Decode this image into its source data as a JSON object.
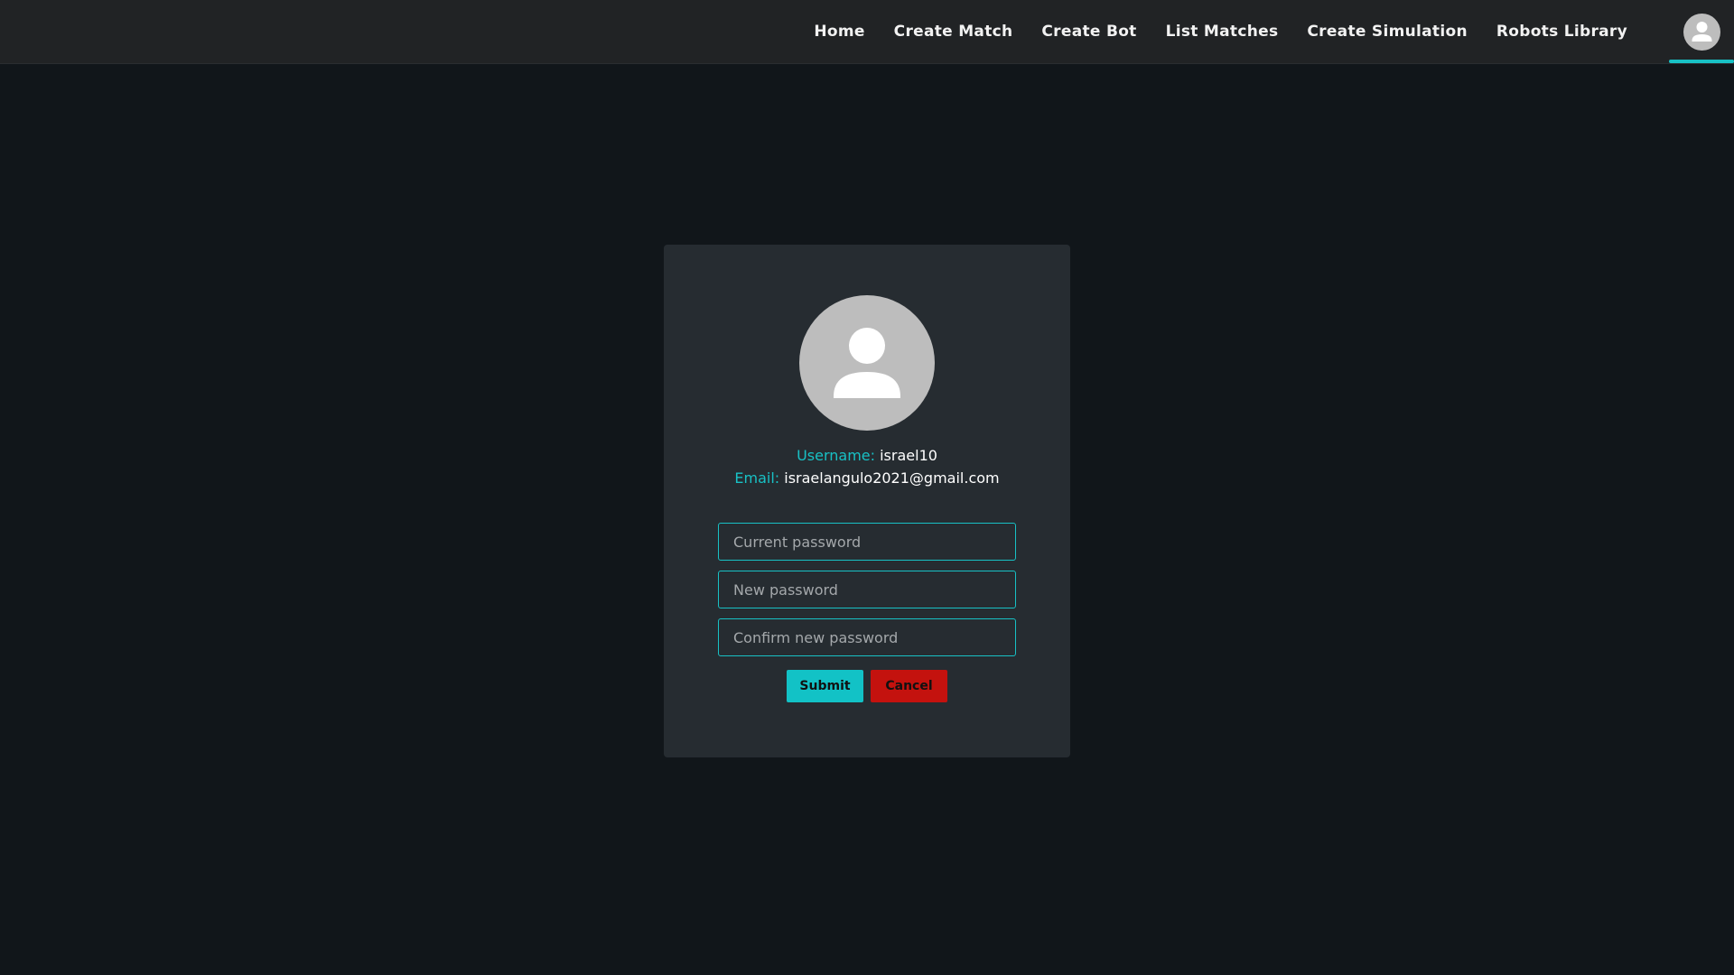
{
  "navbar": {
    "links": [
      "Home",
      "Create Match",
      "Create Bot",
      "List Matches",
      "Create Simulation",
      "Robots Library"
    ],
    "avatar_icon": "account-circle-icon"
  },
  "profile": {
    "avatar_icon": "user-silhouette-icon",
    "username_label": "Username:",
    "username_value": "israel10",
    "email_label": "Email:",
    "email_value": "israelangulo2021@gmail.com"
  },
  "form": {
    "current_password": {
      "placeholder": "Current password",
      "value": ""
    },
    "new_password": {
      "placeholder": "New password",
      "value": ""
    },
    "confirm_password": {
      "placeholder": "Confirm new password",
      "value": ""
    },
    "submit_label": "Submit",
    "cancel_label": "Cancel"
  },
  "colors": {
    "accent": "#18c1c5",
    "danger": "#c4120e",
    "background": "#11161a",
    "card": "#262c31",
    "navbar": "#212325"
  }
}
